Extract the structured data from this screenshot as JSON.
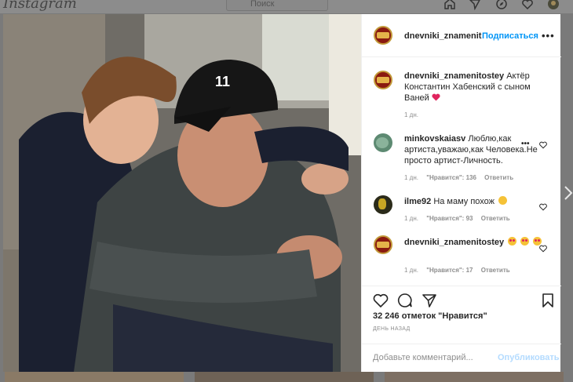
{
  "topbar": {
    "logo": "Instagram",
    "search_placeholder": "Поиск",
    "icons": [
      "home-icon",
      "direct-icon",
      "explore-icon",
      "activity-icon",
      "profile-avatar"
    ]
  },
  "post": {
    "author": "dnevniki_znamenit",
    "follow_label": "Подписаться",
    "more_label": "•••",
    "caption": {
      "username": "dnevniki_znamenitostey",
      "text": "Актёр Константин Хабенский с сыном Ваней",
      "time": "1 дн."
    },
    "comments": [
      {
        "username": "minkovskaiasv",
        "text": "Люблю,как артиста,уважаю,как Человека.Не просто артист-Личность.",
        "time": "1 дн.",
        "likes": "\"Нравится\": 136",
        "reply": "Ответить"
      },
      {
        "username": "ilme92",
        "text": "На маму похож",
        "time": "1 дн.",
        "likes": "\"Нравится\": 93",
        "reply": "Ответить"
      },
      {
        "username": "dnevniki_znamenitostey",
        "text": "",
        "time": "1 дн.",
        "likes": "\"Нравится\": 17",
        "reply": "Ответить"
      }
    ],
    "likes_count": "32 246 отметок \"Нравится\"",
    "date": "ДЕНЬ НАЗАД",
    "add_comment_placeholder": "Добавьте комментарий...",
    "publish_label": "Опубликовать"
  },
  "colors": {
    "accent": "#0095f6",
    "publish_disabled": "#b3dbff",
    "heart": "#e0245e",
    "overlay": "#7a7a7a"
  }
}
